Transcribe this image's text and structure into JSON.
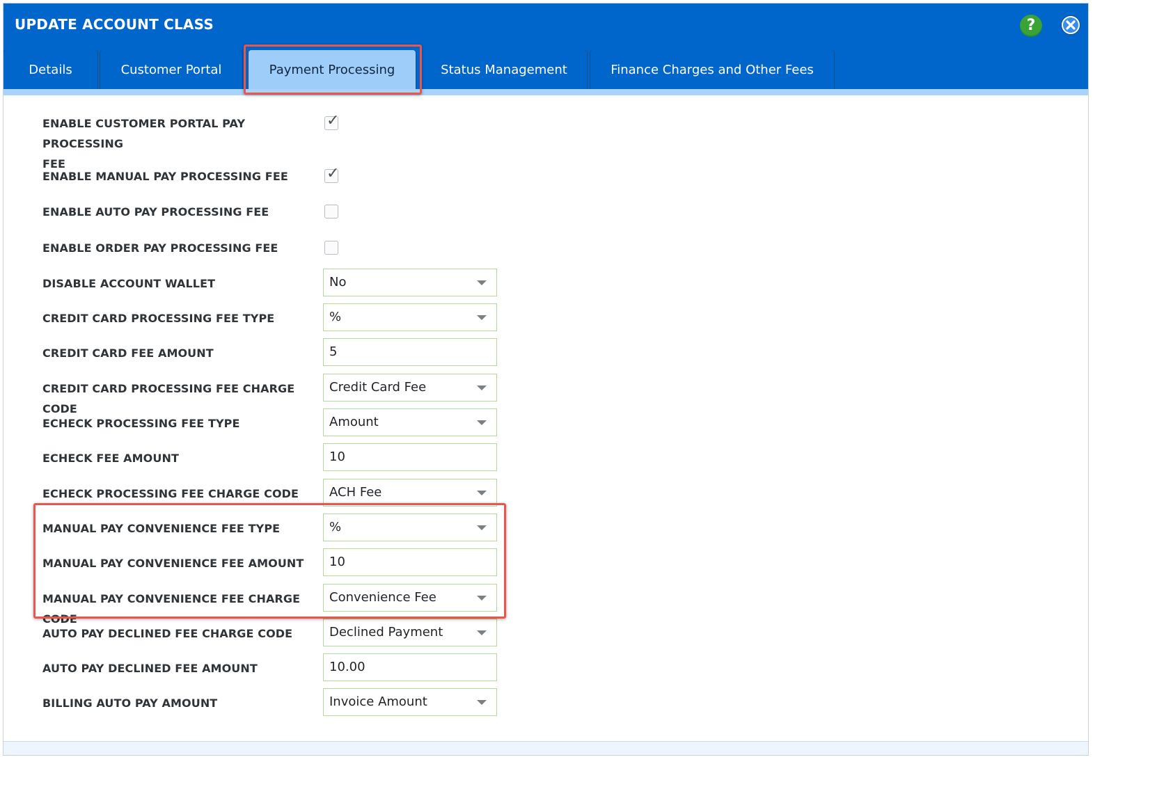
{
  "window": {
    "title": "UPDATE ACCOUNT CLASS",
    "help_label": "?"
  },
  "tabs": [
    {
      "label": "Details",
      "active": false
    },
    {
      "label": "Customer Portal",
      "active": false
    },
    {
      "label": "Payment Processing",
      "active": true
    },
    {
      "label": "Status Management",
      "active": false
    },
    {
      "label": "Finance Charges and Other Fees",
      "active": false
    }
  ],
  "colors": {
    "header_blue": "#0066cc",
    "active_tab": "#9fcdfa",
    "highlight_red": "#e9564e",
    "help_green": "#3aa336"
  },
  "form": {
    "enable_customer_portal_pay_processing_fee": {
      "label_line1": "ENABLE CUSTOMER PORTAL PAY PROCESSING",
      "label_line2": "FEE",
      "checked": true
    },
    "enable_manual_pay_processing_fee": {
      "label": "ENABLE MANUAL PAY PROCESSING FEE",
      "checked": true
    },
    "enable_auto_pay_processing_fee": {
      "label": "ENABLE AUTO PAY PROCESSING FEE",
      "checked": false
    },
    "enable_order_pay_processing_fee": {
      "label": "ENABLE ORDER PAY PROCESSING FEE",
      "checked": false
    },
    "disable_account_wallet": {
      "label": "DISABLE ACCOUNT WALLET",
      "value": "No",
      "type": "select"
    },
    "credit_card_processing_fee_type": {
      "label": "CREDIT CARD PROCESSING FEE TYPE",
      "value": "%",
      "type": "select"
    },
    "credit_card_fee_amount": {
      "label": "CREDIT CARD FEE AMOUNT",
      "value": "5",
      "type": "input"
    },
    "credit_card_processing_fee_charge_code": {
      "label": "CREDIT CARD PROCESSING FEE CHARGE CODE",
      "value": "Credit Card Fee",
      "type": "select"
    },
    "echeck_processing_fee_type": {
      "label": "ECHECK PROCESSING FEE TYPE",
      "value": "Amount",
      "type": "select"
    },
    "echeck_fee_amount": {
      "label": "ECHECK FEE AMOUNT",
      "value": "10",
      "type": "input"
    },
    "echeck_processing_fee_charge_code": {
      "label": "ECHECK PROCESSING FEE CHARGE CODE",
      "value": "ACH Fee",
      "type": "select"
    },
    "manual_pay_convenience_fee_type": {
      "label": "MANUAL PAY CONVENIENCE FEE TYPE",
      "value": "%",
      "type": "select"
    },
    "manual_pay_convenience_fee_amount": {
      "label": "MANUAL PAY CONVENIENCE FEE AMOUNT",
      "value": "10",
      "type": "input"
    },
    "manual_pay_convenience_fee_charge_code": {
      "label": "MANUAL PAY CONVENIENCE FEE CHARGE CODE",
      "value": "Convenience Fee",
      "type": "select"
    },
    "auto_pay_declined_fee_charge_code": {
      "label": "AUTO PAY DECLINED FEE CHARGE CODE",
      "value": "Declined Payment",
      "type": "select"
    },
    "auto_pay_declined_fee_amount": {
      "label": "AUTO PAY DECLINED FEE AMOUNT",
      "value": "10.00",
      "type": "input"
    },
    "billing_auto_pay_amount": {
      "label": "BILLING AUTO PAY AMOUNT",
      "value": "Invoice Amount",
      "type": "select"
    }
  }
}
